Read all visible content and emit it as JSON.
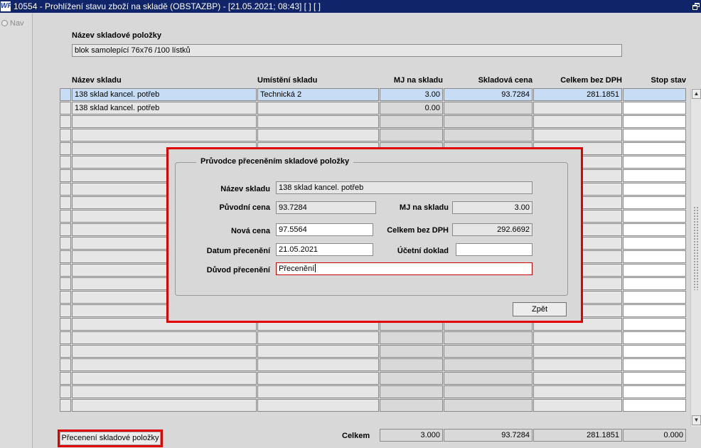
{
  "window": {
    "title": "10554 - Prohlížení stavu zboží na skladě (OBSTAZBP) - [21.05.2021; 08:43]  [ ]  [ ]",
    "app_icon_text": "WF"
  },
  "nav": {
    "label": "Nav"
  },
  "item": {
    "label": "Název skladové položky",
    "value": "blok samolepící 76x76 /100 lístků"
  },
  "table": {
    "columns": [
      "Název skladu",
      "Umístění skladu",
      "MJ na skladu",
      "Skladová cena",
      "Celkem bez DPH",
      "Stop stav"
    ],
    "rows": [
      {
        "warehouse": "138 sklad kancel. potřeb",
        "location": "Technická 2",
        "qty": "3.00",
        "price": "93.7284",
        "total": "281.1851",
        "stop": "",
        "selected": true
      },
      {
        "warehouse": "138 sklad kancel. potřeb",
        "location": "",
        "qty": "0.00",
        "price": "",
        "total": "",
        "stop": "",
        "selected": false
      }
    ],
    "empty_row_count": 22
  },
  "totals": {
    "label": "Celkem",
    "qty": "3.000",
    "price": "93.7284",
    "total": "281.1851",
    "stop": "0.000"
  },
  "reprice_button": {
    "label": "Přecenení skladové položky"
  },
  "dialog": {
    "title": "Průvodce přeceněním skladové položky",
    "warehouse_label": "Název skladu",
    "warehouse_value": "138 sklad kancel. potřeb",
    "orig_price_label": "Původní cena",
    "orig_price_value": "93.7284",
    "qty_label": "MJ na skladu",
    "qty_value": "3.00",
    "new_price_label": "Nová cena",
    "new_price_value": "97.5564",
    "total_label": "Celkem bez DPH",
    "total_value": "292.6692",
    "date_label": "Datum přecenění",
    "date_value": "21.05.2021",
    "doc_label": "Účetní doklad",
    "doc_value": "",
    "reason_label": "Důvod přecenění",
    "reason_value": "Přecenění",
    "back_label": "Zpět"
  },
  "colors": {
    "titlebar": "#10246a",
    "highlight": "#e00000",
    "selected_row": "#c6ddf5"
  },
  "icons": [
    "app-logo-icon",
    "restore-window-icon",
    "scroll-up-icon",
    "scroll-down-icon"
  ]
}
